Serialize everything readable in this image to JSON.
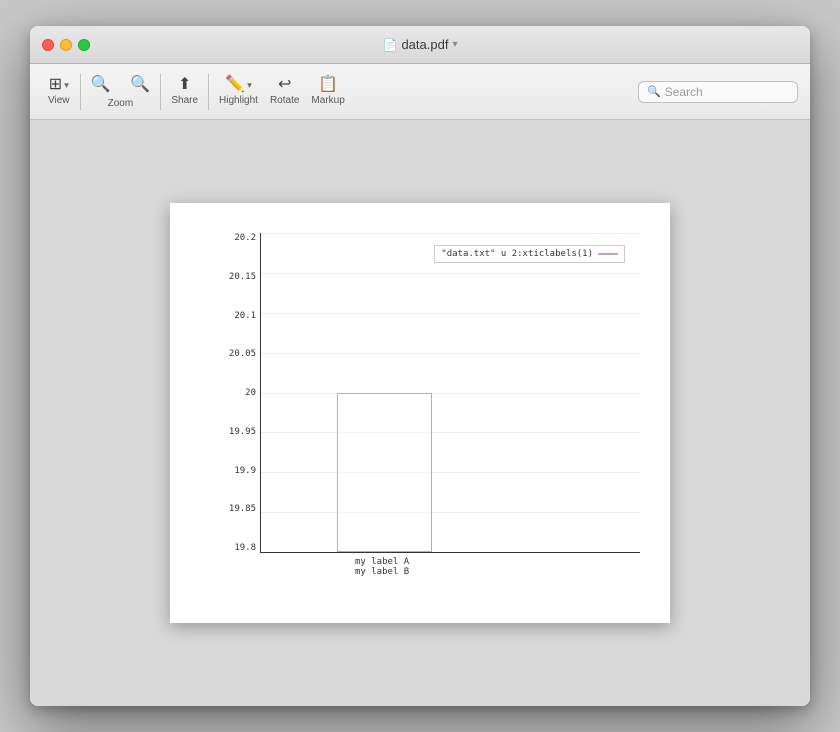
{
  "window": {
    "title": "data.pdf",
    "title_icon": "📄"
  },
  "toolbar": {
    "view_label": "View",
    "zoom_label": "Zoom",
    "share_label": "Share",
    "highlight_label": "Highlight",
    "rotate_label": "Rotate",
    "markup_label": "Markup",
    "search_label": "Search",
    "search_placeholder": "Search"
  },
  "chart": {
    "legend_text": "\"data.txt\" u 2:xticlabels(1)",
    "y_labels": [
      "20.2",
      "20.15",
      "20.1",
      "20.05",
      "20",
      "19.95",
      "19.9",
      "19.85",
      "19.8"
    ],
    "x_label_1": "my label A",
    "x_label_2": "my label B"
  }
}
